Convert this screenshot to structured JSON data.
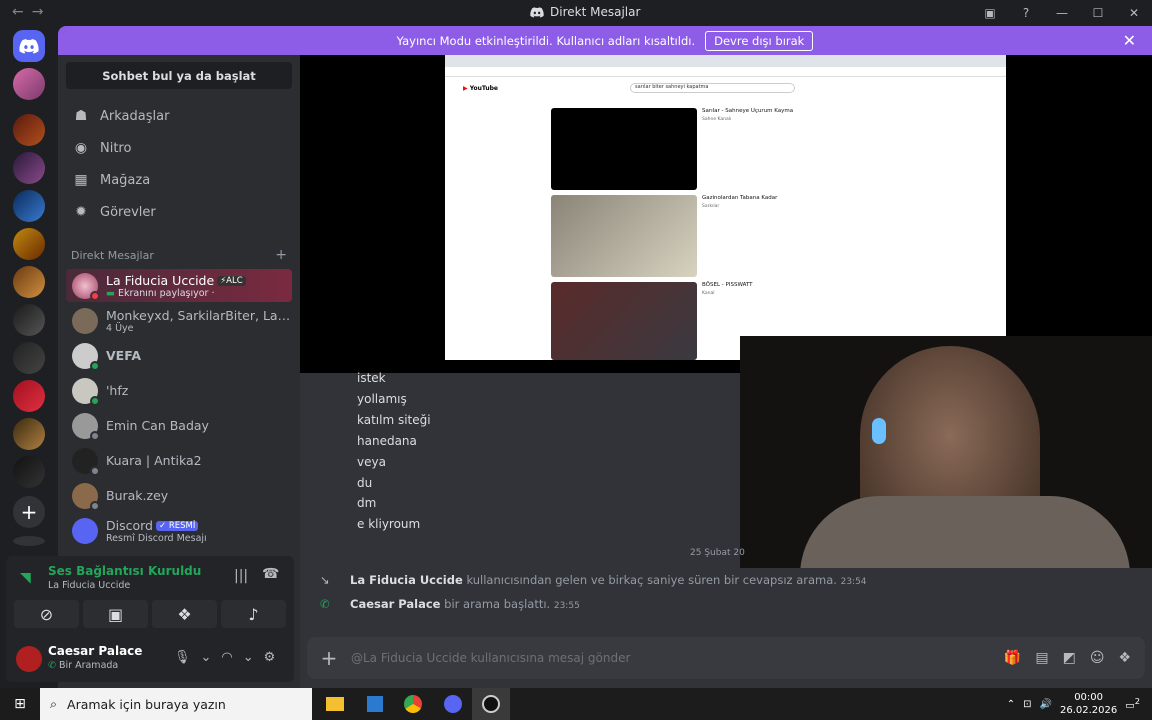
{
  "window": {
    "title": "Direkt Mesajlar",
    "back": "←",
    "forward": "→"
  },
  "streamer_mode": {
    "text": "Yayıncı Modu etkinleştirildi. Kullanıcı adları kısaltıldı.",
    "button": "Devre dışı bırak"
  },
  "sidebar": {
    "search": "Sohbet bul ya da başlat",
    "nav": [
      {
        "label": "Arkadaşlar",
        "icon": "friends-icon"
      },
      {
        "label": "Nitro",
        "icon": "nitro-icon"
      },
      {
        "label": "Mağaza",
        "icon": "shop-icon"
      },
      {
        "label": "Görevler",
        "icon": "quests-icon"
      }
    ],
    "dm_header": "Direkt Mesajlar",
    "dms": [
      {
        "name": "La Fiducia Uccide",
        "tag": "⚡ALC",
        "sub": "Ekranını paylaşıyor ·"
      },
      {
        "name": "Monkeyxd, SarkilarBiter, La ...",
        "sub": "4 Üye"
      },
      {
        "name": "VEFA",
        "sub": ""
      },
      {
        "name": "'hfz",
        "sub": ""
      },
      {
        "name": "Emin Can Baday",
        "sub": ""
      },
      {
        "name": "Kuara | Antika2",
        "sub": ""
      },
      {
        "name": "Burak.zey",
        "sub": ""
      },
      {
        "name": "Discord",
        "tag": "✓ RESMİ",
        "sub": "Resmî Discord Mesajı"
      }
    ]
  },
  "voice": {
    "status": "Ses Bağlantısı Kuruldu",
    "channel": "La Fiducia Uccide"
  },
  "user": {
    "name": "Caesar Palace",
    "status": "Bir Aramada"
  },
  "messages": [
    "istek",
    "yollamış",
    "katılm siteği",
    "hanedana",
    "veya",
    "du",
    "dm",
    "e kliyroum"
  ],
  "date_separator": "25 Şubat 20",
  "calls": [
    {
      "who": "La Fiducia Uccide",
      "text": "kullanıcısından gelen ve birkaç saniye süren bir cevapsız arama.",
      "time": "23:54"
    },
    {
      "who": "Caesar Palace",
      "text": "bir arama başlattı.",
      "time": "23:55"
    }
  ],
  "composer": {
    "placeholder": "@La Fiducia Uccide kullanıcısına mesaj gönder"
  },
  "stream": {
    "youtube": "YouTube",
    "query": "sarılar biter sahneyi kapatma",
    "videos": [
      {
        "title": "Sarılar - Sahneye Uçurum Kayma",
        "channel": "Sahne Kanalı"
      },
      {
        "title": "Gazinolardan Tabana Kadar",
        "channel": "Sarkılar"
      },
      {
        "title": "BÖSEL - PISSWATT",
        "channel": "Kanal"
      }
    ]
  },
  "taskbar": {
    "search": "Aramak için buraya yazın",
    "time": "00:00",
    "date": "26.02.2026",
    "notif": "2"
  }
}
